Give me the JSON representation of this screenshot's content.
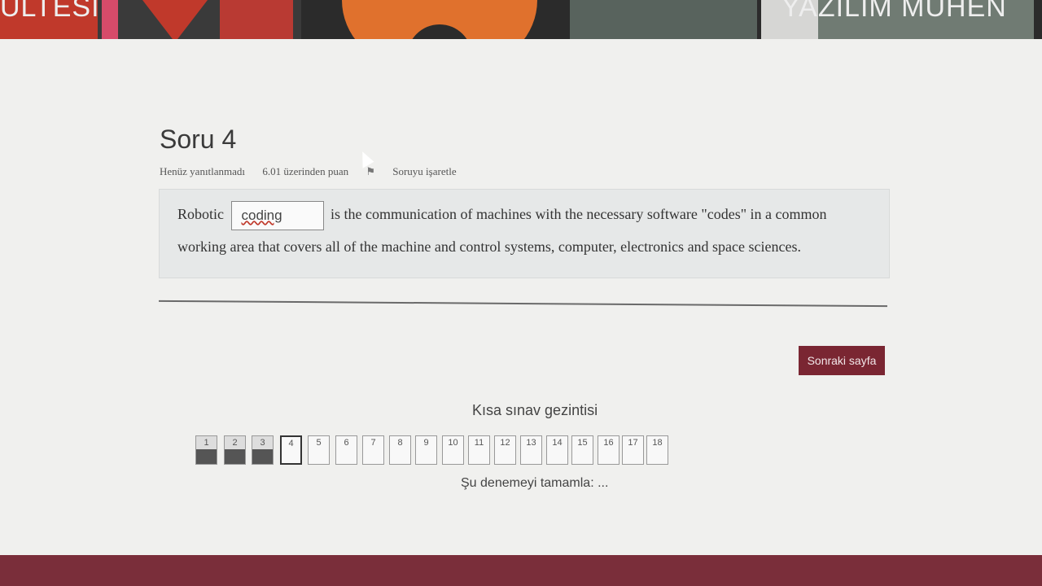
{
  "banner": {
    "left_text": "ÜLTESİ",
    "right_text": "YAZILIM MÜHEN"
  },
  "question": {
    "title": "Soru 4",
    "status": "Henüz yanıtlanmadı",
    "points": "6.01 üzerinden puan",
    "flag_label": "Soruyu işaretle",
    "text_before": "Robotic",
    "answer_value": "coding",
    "text_after": "is the communication of machines with the necessary software \"codes\" in a common working area that covers all of the machine and control systems, computer, electronics and space sciences."
  },
  "actions": {
    "next_label": "Sonraki sayfa"
  },
  "navigation": {
    "title": "Kısa sınav gezintisi",
    "finish_label": "Şu denemeyi tamamla: ...",
    "items": [
      {
        "label": "1",
        "state": "answered"
      },
      {
        "label": "2",
        "state": "answered"
      },
      {
        "label": "3",
        "state": "answered"
      },
      {
        "label": "4",
        "state": "current"
      },
      {
        "label": "5",
        "state": "unanswered"
      },
      {
        "label": "6",
        "state": "unanswered"
      },
      {
        "label": "7",
        "state": "unanswered"
      },
      {
        "label": "8",
        "state": "unanswered"
      },
      {
        "label": "9",
        "state": "unanswered"
      },
      {
        "label": "10",
        "state": "unanswered"
      },
      {
        "label": "11",
        "state": "unanswered"
      },
      {
        "label": "12",
        "state": "unanswered"
      },
      {
        "label": "13",
        "state": "unanswered"
      },
      {
        "label": "14",
        "state": "unanswered"
      },
      {
        "label": "15",
        "state": "unanswered"
      },
      {
        "label": "16",
        "state": "unanswered"
      },
      {
        "label": "17",
        "state": "unanswered"
      },
      {
        "label": "18",
        "state": "unanswered"
      }
    ]
  },
  "colors": {
    "accent": "#7a2632",
    "background": "#f0f0ee"
  }
}
